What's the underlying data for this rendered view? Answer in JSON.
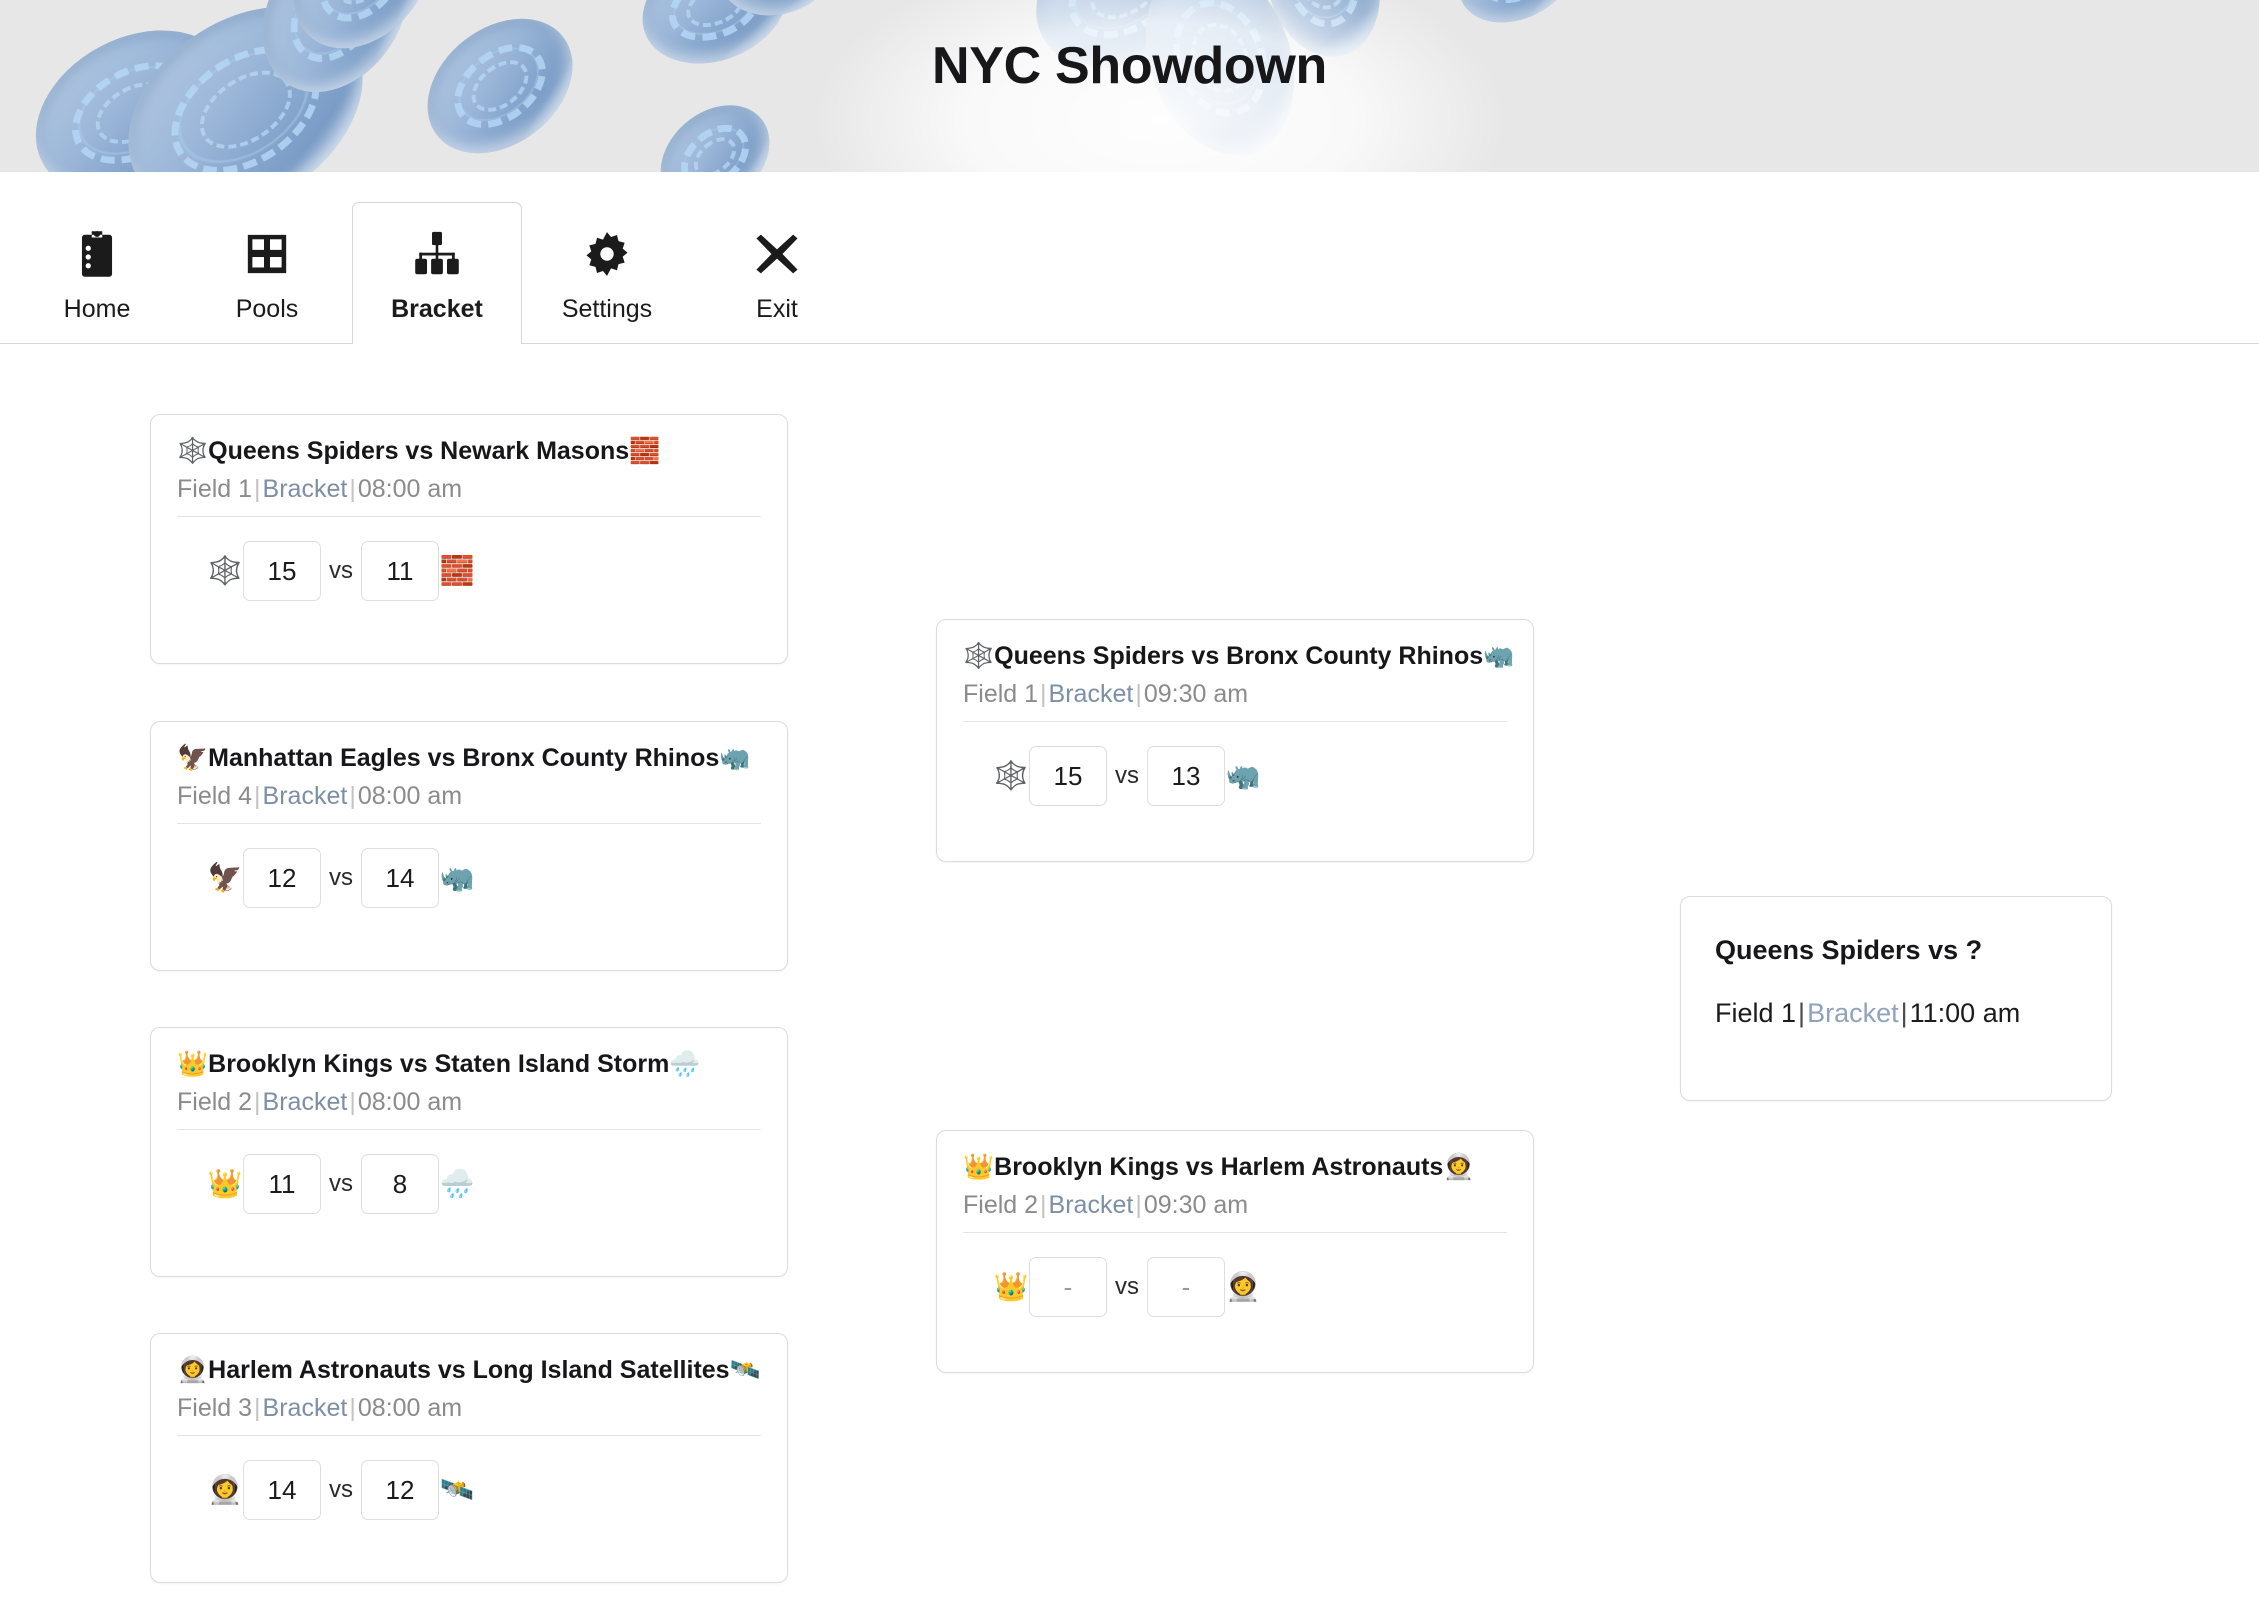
{
  "banner": {
    "title": "NYC Showdown",
    "background_color": "#e7e7e7",
    "disc_color": "#9bb6d8"
  },
  "nav": {
    "tabs": [
      {
        "label": "Home",
        "icon": "clipboard-list-icon",
        "active": false
      },
      {
        "label": "Pools",
        "icon": "grid-table-icon",
        "active": false
      },
      {
        "label": "Bracket",
        "icon": "sitemap-icon",
        "active": true
      },
      {
        "label": "Settings",
        "icon": "gear-icon",
        "active": false
      },
      {
        "label": "Exit",
        "icon": "close-x-icon",
        "active": false
      }
    ]
  },
  "bracket": {
    "round1": [
      {
        "title_emoji_left": "🕸️",
        "title": "Queens Spiders vs Newark Masons",
        "title_emoji_right": "🧱",
        "field": "Field 1",
        "round": "Bracket",
        "time": "08:00 am",
        "team1_emoji": "🕸️",
        "team2_emoji": "🧱",
        "score1": "15",
        "score2": "11",
        "vs": "vs"
      },
      {
        "title_emoji_left": "🦅",
        "title": "Manhattan Eagles vs Bronx County Rhinos",
        "title_emoji_right": "🦏",
        "field": "Field 4",
        "round": "Bracket",
        "time": "08:00 am",
        "team1_emoji": "🦅",
        "team2_emoji": "🦏",
        "score1": "12",
        "score2": "14",
        "vs": "vs"
      },
      {
        "title_emoji_left": "👑",
        "title": "Brooklyn Kings vs Staten Island Storm",
        "title_emoji_right": "🌧️",
        "field": "Field 2",
        "round": "Bracket",
        "time": "08:00 am",
        "team1_emoji": "👑",
        "team2_emoji": "🌧️",
        "score1": "11",
        "score2": "8",
        "vs": "vs"
      },
      {
        "title_emoji_left": "👩‍🚀",
        "title": "Harlem Astronauts vs Long Island Satellites",
        "title_emoji_right": "🛰️",
        "field": "Field 3",
        "round": "Bracket",
        "time": "08:00 am",
        "team1_emoji": "👩‍🚀",
        "team2_emoji": "🛰️",
        "score1": "14",
        "score2": "12",
        "vs": "vs"
      }
    ],
    "round2": [
      {
        "title_emoji_left": "🕸️",
        "title": "Queens Spiders vs Bronx County Rhinos",
        "title_emoji_right": "🦏",
        "field": "Field 1",
        "round": "Bracket",
        "time": "09:30 am",
        "team1_emoji": "🕸️",
        "team2_emoji": "🦏",
        "score1": "15",
        "score2": "13",
        "vs": "vs"
      },
      {
        "title_emoji_left": "👑",
        "title": "Brooklyn Kings vs Harlem Astronauts",
        "title_emoji_right": "👩‍🚀",
        "field": "Field 2",
        "round": "Bracket",
        "time": "09:30 am",
        "team1_emoji": "👑",
        "team2_emoji": "👩‍🚀",
        "score1": "-",
        "score2": "-",
        "vs": "vs"
      }
    ],
    "final": {
      "title": "Queens Spiders vs ?",
      "field": "Field 1",
      "round": "Bracket",
      "time": "11:00 am"
    },
    "separator": "|"
  }
}
